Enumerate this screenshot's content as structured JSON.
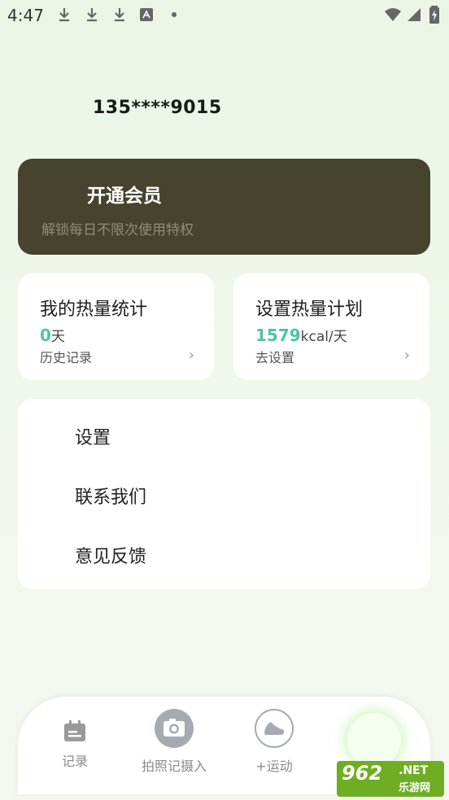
{
  "status_bar": {
    "time": "4:47"
  },
  "profile": {
    "phone": "135****9015"
  },
  "vip": {
    "title": "开通会员",
    "subtitle": "解锁每日不限次使用特权"
  },
  "stats": {
    "calories": {
      "title": "我的热量统计",
      "value": "0",
      "unit": "天",
      "link": "历史记录",
      "chevron": "›"
    },
    "plan": {
      "title": "设置热量计划",
      "value": "1579",
      "unit": "kcal/天",
      "link": "去设置",
      "chevron": "›"
    }
  },
  "menu": {
    "items": [
      {
        "label": "设置"
      },
      {
        "label": "联系我们"
      },
      {
        "label": "意见反馈"
      }
    ]
  },
  "bottom_nav": {
    "items": [
      {
        "label": "记录",
        "icon": "calendar-icon"
      },
      {
        "label": "拍照记摄入",
        "icon": "camera-icon"
      },
      {
        "label": "+运动",
        "icon": "sneaker-icon"
      }
    ]
  },
  "watermark": {
    "number": "962",
    "net": ".NET",
    "cn": "乐游网"
  },
  "colors": {
    "accent": "#4dc3a6",
    "vip_bg": "#46442f",
    "background": "#eaf5e6"
  }
}
